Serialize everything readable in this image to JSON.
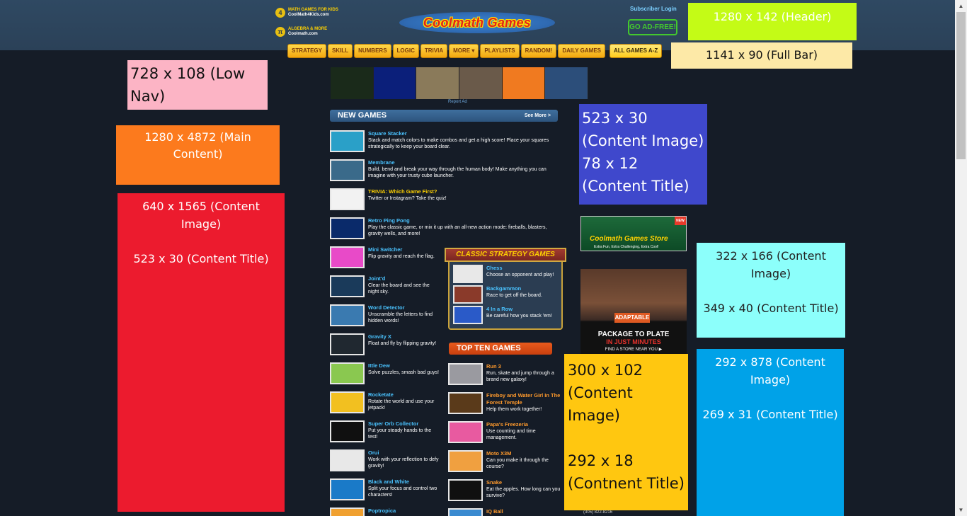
{
  "header": {
    "side_links": [
      {
        "line1": "MATH GAMES FOR KIDS",
        "line2": "CoolMath4Kids.com",
        "icon": "4"
      },
      {
        "line1": "ALGEBRA & MORE",
        "line2": "Coolmath.com",
        "icon": "π"
      }
    ],
    "logo": "Coolmath Games",
    "subscriber_login": "Subscriber Login",
    "ad_free": "GO AD-FREE!"
  },
  "nav": {
    "items": [
      "STRATEGY",
      "SKILL",
      "NUMBERS",
      "LOGIC",
      "TRIVIA",
      "MORE ▾",
      "PLAYLISTS",
      "RANDOM!",
      "DAILY GAMES"
    ],
    "all_games": "ALL GAMES A-Z"
  },
  "ad_strip": {
    "report_ad": "Report Ad",
    "tiles": [
      "#1a2a1a",
      "#0b1f7a",
      "#8a7a5a",
      "#6a5a4a",
      "#f07a20",
      "#2c4e7a"
    ]
  },
  "new_games": {
    "title": "NEW GAMES",
    "see_more": "See More >",
    "items": [
      {
        "title": "Square Stacker",
        "desc": "Stack and match colors to make combos and get a high score! Place your squares strategically to keep your board clear.",
        "color": "#2aa0c8",
        "style": "blue"
      },
      {
        "title": "Membrane",
        "desc": "Build, bend and break your way through the human body! Make anything you can imagine with your trusty cube launcher.",
        "color": "#3a6a8a",
        "style": "blue"
      },
      {
        "title": "TRIVIA: Which Game First?",
        "desc": "Twitter or Instagram? Take the quiz!",
        "color": "#f2f2f2",
        "style": "yellow"
      },
      {
        "title": "Retro Ping Pong",
        "desc": "Play the classic game, or mix it up with an all-new action mode: fireballs, blasters, gravity wells, and more!",
        "color": "#0a2a6a",
        "style": "blue"
      },
      {
        "title": "Mini Switcher",
        "desc": "Flip gravity and reach the flag.",
        "color": "#e84ac8",
        "style": "blue"
      },
      {
        "title": "Joint'd",
        "desc": "Clear the board and see the night sky.",
        "color": "#1a3a5a",
        "style": "blue"
      },
      {
        "title": "Word Detector",
        "desc": "Unscramble the letters to find hidden words!",
        "color": "#3a7ab0",
        "style": "blue"
      },
      {
        "title": "Gravity X",
        "desc": "Float and fly by flipping gravity!",
        "color": "#202830",
        "style": "blue"
      },
      {
        "title": "Ittle Dew",
        "desc": "Solve puzzles, smash bad guys!",
        "color": "#8ac850",
        "style": "blue"
      },
      {
        "title": "Rocketate",
        "desc": "Rotate the world and use your jetpack!",
        "color": "#f2c020",
        "style": "blue"
      },
      {
        "title": "Super Orb Collector",
        "desc": "Put your steady hands to the test!",
        "color": "#101010",
        "style": "blue"
      },
      {
        "title": "Orui",
        "desc": "Work with your reflection to defy gravity!",
        "color": "#e8e8e8",
        "style": "blue"
      },
      {
        "title": "Black and White",
        "desc": "Split your focus and control two characters!",
        "color": "#1a7ac8",
        "style": "blue"
      },
      {
        "title": "Poptropica",
        "desc": "",
        "color": "#f0a030",
        "style": "blue"
      }
    ]
  },
  "strategy": {
    "title": "CLASSIC STRATEGY GAMES",
    "items": [
      {
        "title": "Chess",
        "desc": "Choose an opponent and play!",
        "color": "#e8e8e8"
      },
      {
        "title": "Backgammon",
        "desc": "Race to get off the board.",
        "color": "#8a3a2a"
      },
      {
        "title": "4 In a Row",
        "desc": "Be careful how you stack 'em!",
        "color": "#2a5ac8"
      }
    ]
  },
  "top_ten": {
    "title": "TOP TEN GAMES",
    "items": [
      {
        "title": "Run 3",
        "desc": "Run, skate and jump through a brand new galaxy!",
        "color": "#9a9aa0"
      },
      {
        "title": "Fireboy and Water Girl In The Forest Temple",
        "desc": "Help them work together!",
        "color": "#5a3a1a"
      },
      {
        "title": "Papa's Freezeria",
        "desc": "Use counting and time management.",
        "color": "#e85aa0"
      },
      {
        "title": "Moto X3M",
        "desc": "Can you make it through the course?",
        "color": "#f0a040"
      },
      {
        "title": "Snake",
        "desc": "Eat the apples. How long can you survive?",
        "color": "#101010"
      },
      {
        "title": "IQ Ball",
        "desc": "",
        "color": "#3a8ad0"
      }
    ]
  },
  "right_ads": {
    "store_title": "Coolmath Games Store",
    "store_sub": "Extra Fun, Extra Challenging, Extra Cool!",
    "store_badge": "NEW",
    "food_brand": "ADAPTABLE",
    "food_line1": "PACKAGE TO PLATE",
    "food_line2": "IN JUST MINUTES",
    "food_line3": "FIND A STORE NEAR YOU ▶",
    "food_phone": "(305) 822-8216"
  },
  "overlays": {
    "header": "1280 x 142 (Header)",
    "full_bar": "1141 x 90 (Full Bar)",
    "low_nav_1": "728 x 108 (Low",
    "low_nav_2": "Nav)",
    "main_1": "1280 x 4872 (Main",
    "main_2": "Content)",
    "content_left_1": "640 x 1565 (Content",
    "content_left_2": "Image)",
    "content_left_3": "523 x 30 (Content Title)",
    "blue_1": "523 x 30",
    "blue_2": "(Content Image)",
    "blue_3": "78 x 12",
    "blue_4": "(Content Title)",
    "cyan_1": "322 x 166 (Content",
    "cyan_2": "Image)",
    "cyan_3": "349 x 40 (Content Title)",
    "yellow_1": "300 x 102",
    "yellow_2": "(Content",
    "yellow_3": "Image)",
    "yellow_4": "292 x 18",
    "yellow_5": "(Contnent Title)",
    "sky_1": "292 x 878 (Content",
    "sky_2": "Image)",
    "sky_3": "269 x 31 (Content Title)"
  }
}
